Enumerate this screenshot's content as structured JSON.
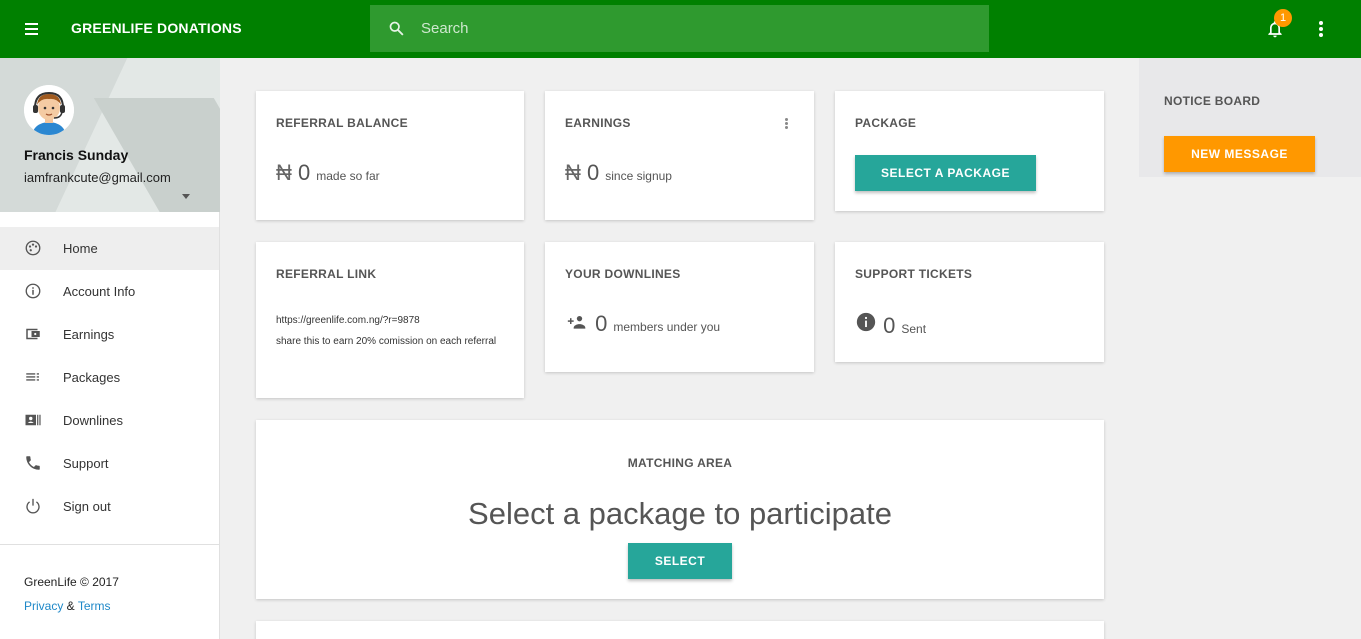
{
  "header": {
    "brand": "GREENLIFE DONATIONS",
    "search_placeholder": "Search",
    "notification_count": "1",
    "menu_icon": "menu-icon",
    "more_icon": "more-vert-icon"
  },
  "profile": {
    "name": "Francis Sunday",
    "email": "iamfrankcute@gmail.com"
  },
  "sidebar": {
    "items": [
      {
        "label": "Home",
        "icon": "dashboard-icon",
        "active": true
      },
      {
        "label": "Account Info",
        "icon": "info-icon"
      },
      {
        "label": "Earnings",
        "icon": "wallet-icon"
      },
      {
        "label": "Packages",
        "icon": "list-icon"
      },
      {
        "label": "Downlines",
        "icon": "contacts-icon"
      },
      {
        "label": "Support",
        "icon": "phone-icon"
      },
      {
        "label": "Sign out",
        "icon": "power-icon"
      }
    ],
    "footer": {
      "copyright": "GreenLife © 2017",
      "privacy": "Privacy",
      "amp": " & ",
      "terms": "Terms"
    }
  },
  "cards": {
    "referral_balance": {
      "title": "REFERRAL BALANCE",
      "currency": "₦",
      "value": "0",
      "sub": "made so far"
    },
    "earnings": {
      "title": "EARNINGS",
      "currency": "₦",
      "value": "0",
      "sub": "since signup"
    },
    "package": {
      "title": "PACKAGE",
      "button": "SELECT A PACKAGE"
    },
    "referral_link": {
      "title": "REFERRAL LINK",
      "url": "https://greenlife.com.ng/?r=9878",
      "note": "share this to earn 20% comission on each referral"
    },
    "downlines": {
      "title": "YOUR DOWNLINES",
      "value": "0",
      "sub": "members under you"
    },
    "support": {
      "title": "SUPPORT TICKETS",
      "value": "0",
      "sub": "Sent"
    }
  },
  "matching": {
    "title": "MATCHING AREA",
    "message": "Select a package to participate",
    "button": "SELECT"
  },
  "notice_board": {
    "title": "NOTICE BOARD",
    "button": "NEW MESSAGE"
  },
  "colors": {
    "header": "#008000",
    "search": "#2f9a2f",
    "accent_teal": "#26a69a",
    "accent_orange": "#ff9800",
    "link": "#1e88c8"
  }
}
